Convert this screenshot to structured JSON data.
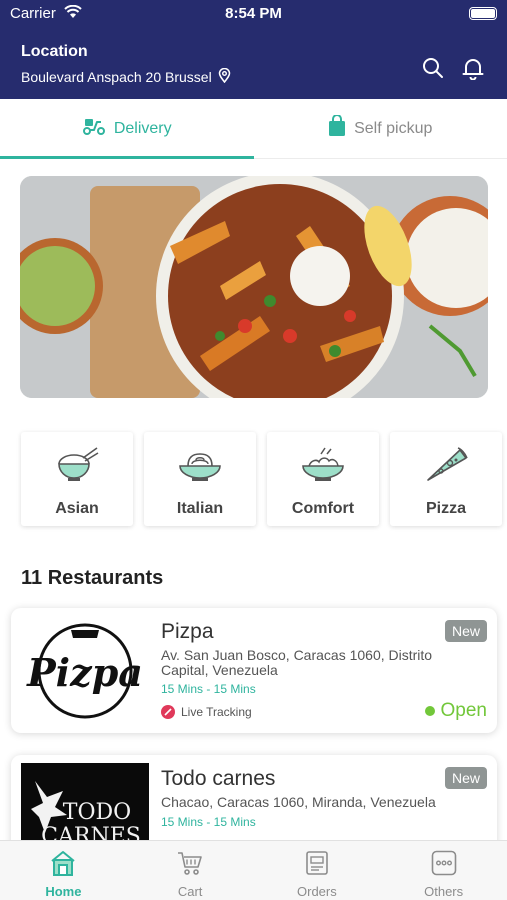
{
  "status_bar": {
    "carrier": "Carrier",
    "time": "8:54 PM"
  },
  "header": {
    "location_label": "Location",
    "address": "Boulevard Anspach 20 Brussel"
  },
  "tabs": [
    {
      "label": "Delivery",
      "icon": "scooter-icon",
      "active": true
    },
    {
      "label": "Self pickup",
      "icon": "shopping-bag-icon",
      "active": false
    }
  ],
  "categories": [
    {
      "label": "Asian",
      "icon": "rice-bowl-icon"
    },
    {
      "label": "Italian",
      "icon": "pasta-icon"
    },
    {
      "label": "Comfort",
      "icon": "salad-bowl-icon"
    },
    {
      "label": "Pizza",
      "icon": "pizza-slice-icon"
    }
  ],
  "restaurants_title": "11 Restaurants",
  "restaurants": [
    {
      "name": "Pizpa",
      "badge": "New",
      "address": "Av. San Juan Bosco, Caracas 1060, Distrito Capital, Venezuela",
      "time": "15  Mins - 15  Mins",
      "tracking": "Live Tracking",
      "status": "Open",
      "logo_text": "Pizpa"
    },
    {
      "name": "Todo carnes",
      "badge": "New",
      "address": "Chacao, Caracas 1060, Miranda, Venezuela",
      "time": "15  Mins - 15  Mins",
      "logo_text_1": "TODO",
      "logo_text_2": "CARNES"
    }
  ],
  "bottom_nav": [
    {
      "label": "Home",
      "icon": "home-icon",
      "active": true
    },
    {
      "label": "Cart",
      "icon": "cart-icon",
      "active": false
    },
    {
      "label": "Orders",
      "icon": "orders-icon",
      "active": false
    },
    {
      "label": "Others",
      "icon": "more-icon",
      "active": false
    }
  ],
  "colors": {
    "header_bg": "#262c6e",
    "accent": "#2fb49e",
    "open_green": "#72c73a",
    "badge_gray": "#8f9594"
  }
}
